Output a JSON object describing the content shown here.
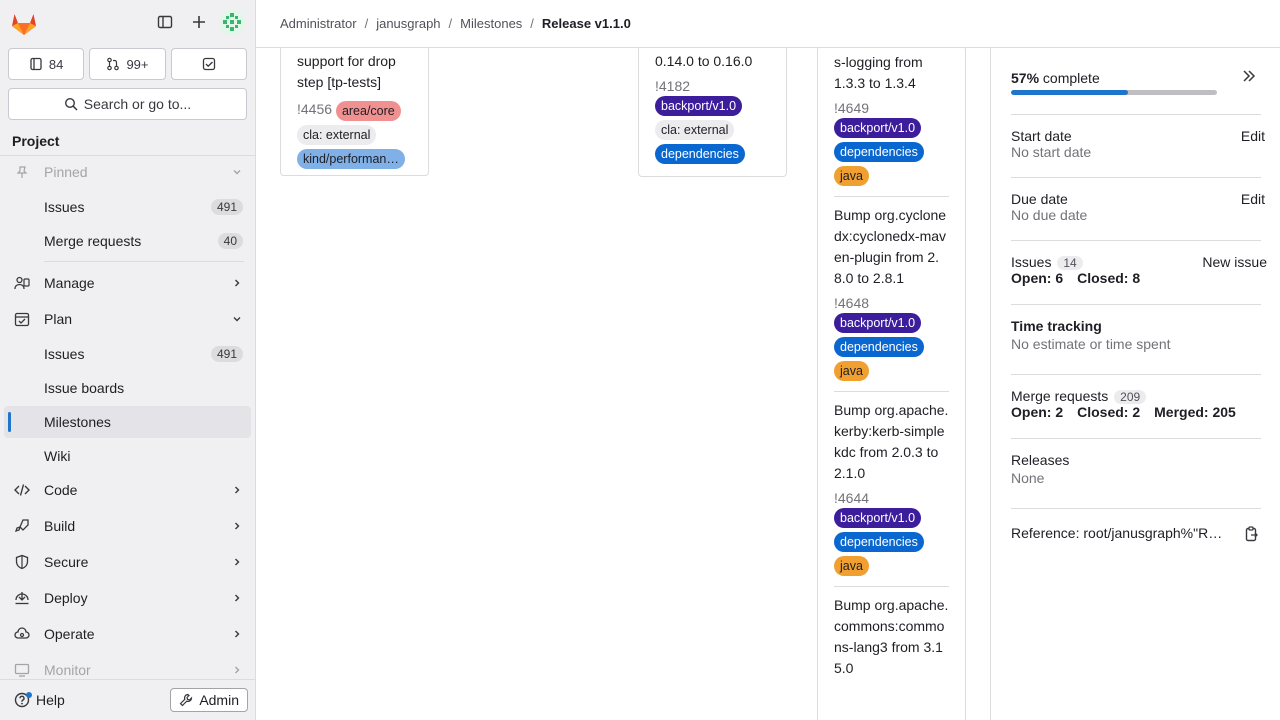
{
  "colors": {
    "accent": "#1f75cb",
    "label_backport": "#3c1e9c",
    "label_dependencies": "#0b67d0",
    "label_java": "#f0a030",
    "label_area_core": "#f19090",
    "label_cla": "#ececef",
    "label_kind_perf": "#7fb0e8"
  },
  "sidebar": {
    "counts": [
      {
        "icon": "issues-icon",
        "value": "84"
      },
      {
        "icon": "merge-request-icon",
        "value": "99+"
      },
      {
        "icon": "todo-icon",
        "value": ""
      }
    ],
    "search_label": "Search or go to...",
    "section_title": "Project",
    "pinned_label": "Pinned",
    "pinned_items": [
      {
        "label": "Issues",
        "count": "491"
      },
      {
        "label": "Merge requests",
        "count": "40"
      }
    ],
    "manage_label": "Manage",
    "plan_label": "Plan",
    "plan_items": [
      {
        "label": "Issues",
        "count": "491"
      },
      {
        "label": "Issue boards"
      },
      {
        "label": "Milestones"
      },
      {
        "label": "Wiki"
      }
    ],
    "sections": [
      "Code",
      "Build",
      "Secure",
      "Deploy",
      "Operate",
      "Monitor"
    ],
    "help_label": "Help",
    "admin_label": "Admin"
  },
  "breadcrumb": [
    "Administrator",
    "janusgraph",
    "Milestones",
    "Release v1.1.0"
  ],
  "cards": {
    "card1": {
      "title": "support for drop step [tp-tests]",
      "ref": "!4456",
      "labels": [
        "area/core",
        "cla: external",
        "kind/performan…"
      ]
    },
    "card2": {
      "title": "0.14.0 to 0.16.0",
      "ref": "!4182",
      "labels": [
        "backport/v1.0",
        "cla: external",
        "dependencies"
      ]
    }
  },
  "merge_requests": [
    {
      "title": "s-logging from 1.3.3 to 1.3.4",
      "ref": "!4649",
      "labels": [
        "backport/v1.0",
        "dependencies",
        "java"
      ]
    },
    {
      "title": "Bump org.cyclonedx:cyclonedx-maven-plugin from 2.8.0 to 2.8.1",
      "ref": "!4648",
      "labels": [
        "backport/v1.0",
        "dependencies",
        "java"
      ]
    },
    {
      "title": "Bump org.apache.kerby:kerb-simplekdc from 2.0.3 to 2.1.0",
      "ref": "!4644",
      "labels": [
        "backport/v1.0",
        "dependencies",
        "java"
      ]
    },
    {
      "title": "Bump org.apache.commons:commons-lang3 from 3.15.0",
      "ref": "",
      "labels": []
    }
  ],
  "right_sidebar": {
    "progress_percent": "57%",
    "progress_text": "complete",
    "progress_fraction": 0.57,
    "start_date_label": "Start date",
    "start_date_value": "No start date",
    "due_date_label": "Due date",
    "due_date_value": "No due date",
    "edit_label": "Edit",
    "issues_label": "Issues",
    "issues_count": "14",
    "new_issue_label": "New issue",
    "issues_open": "Open: 6",
    "issues_closed": "Closed: 8",
    "time_tracking_label": "Time tracking",
    "time_tracking_value": "No estimate or time spent",
    "mr_label": "Merge requests",
    "mr_count": "209",
    "mr_open": "Open: 2",
    "mr_closed": "Closed: 2",
    "mr_merged": "Merged: 205",
    "releases_label": "Releases",
    "releases_value": "None",
    "reference_text": "Reference: root/janusgraph%\"R…"
  }
}
